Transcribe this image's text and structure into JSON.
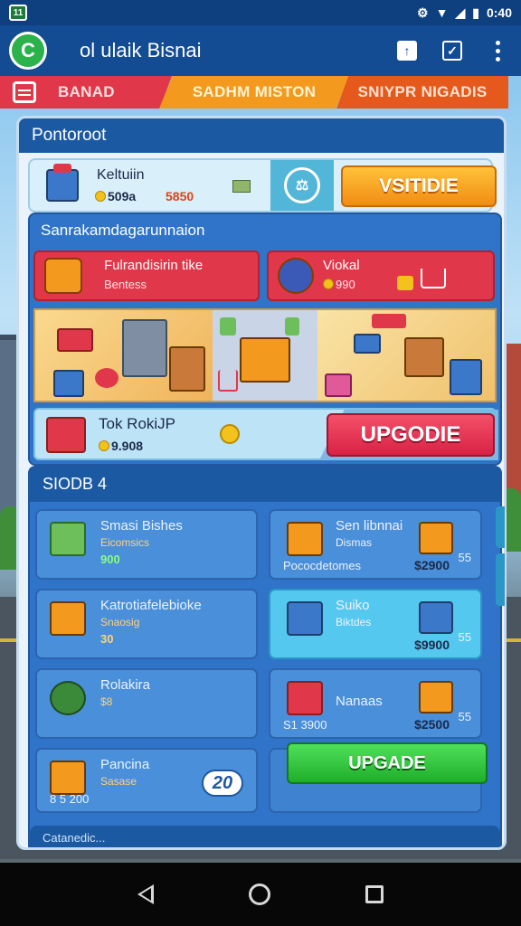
{
  "status_bar": {
    "sim": "11",
    "time": "0:40"
  },
  "app_bar": {
    "logo": "C",
    "title": "ol ulaik Bisnai"
  },
  "tabs": [
    {
      "label": "BANAD"
    },
    {
      "label": "SADHM MISTON"
    },
    {
      "label": "SNIYPR NIGADIS"
    }
  ],
  "panel": {
    "header": "Pontoroot",
    "info": {
      "name": "Keltuiin",
      "value": "509a",
      "value2": "5850",
      "button": "VSITIDIE"
    },
    "section": {
      "title": "Sanrakamdagarunnaion",
      "card1": {
        "title": "Fulrandisirin tike",
        "subtitle": "Bentess"
      },
      "card2": {
        "title": "Viokal",
        "price": "990"
      },
      "upgrade": {
        "title": "Tok RokiJP",
        "price": "9.908",
        "button": "UPGODIE"
      }
    },
    "stock": {
      "header": "SIODB 4",
      "items": [
        {
          "name": "Smasi Bishes",
          "sub": "Eicomsics",
          "price": "900"
        },
        {
          "name": "Sen libnnai",
          "sub": "Dismas",
          "bottom": "Pococdetomes",
          "price": "$2900",
          "small": "55"
        },
        {
          "name": "Katrotiafelebioke",
          "sub": "Snaosig",
          "price": "30"
        },
        {
          "name": "Suiko",
          "sub": "Biktdes",
          "price": "$9900",
          "small": "55"
        },
        {
          "name": "Rolakira",
          "sub": "$8"
        },
        {
          "name": "Nanaas",
          "bottom": "S1 3900",
          "price": "$2500",
          "small": "55"
        },
        {
          "name": "Pancina",
          "sub": "Sasase",
          "bottom": "8 5 200",
          "badge": "20"
        }
      ],
      "button": "UPGADE",
      "footer": "Catanedic..."
    }
  }
}
